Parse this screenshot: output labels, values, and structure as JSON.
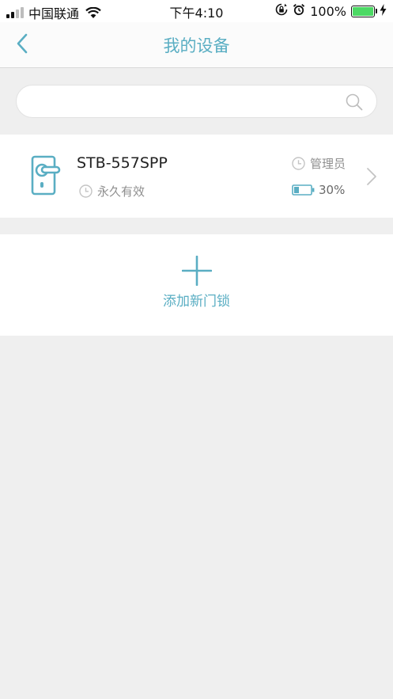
{
  "status_bar": {
    "carrier": "中国联通",
    "time": "下午4:10",
    "battery_percent": "100%",
    "battery_level": 1.0,
    "icons": [
      "signal-icon",
      "wifi-icon",
      "orientation-lock-icon",
      "alarm-icon",
      "battery-icon",
      "charging-icon"
    ]
  },
  "nav": {
    "title": "我的设备",
    "back_icon": "chevron-left-icon"
  },
  "search": {
    "value": "",
    "placeholder": "",
    "icon": "search-icon"
  },
  "device": {
    "name": "STB-557SPP",
    "validity": "永久有效",
    "role": "管理员",
    "battery": "30%",
    "battery_level": 0.3,
    "icon": "door-lock-icon"
  },
  "add_lock": {
    "label": "添加新门锁",
    "icon": "plus-icon"
  },
  "colors": {
    "accent": "#5aaec3",
    "background": "#efefef",
    "card": "#ffffff",
    "secondary_text": "#8f8f8f"
  }
}
